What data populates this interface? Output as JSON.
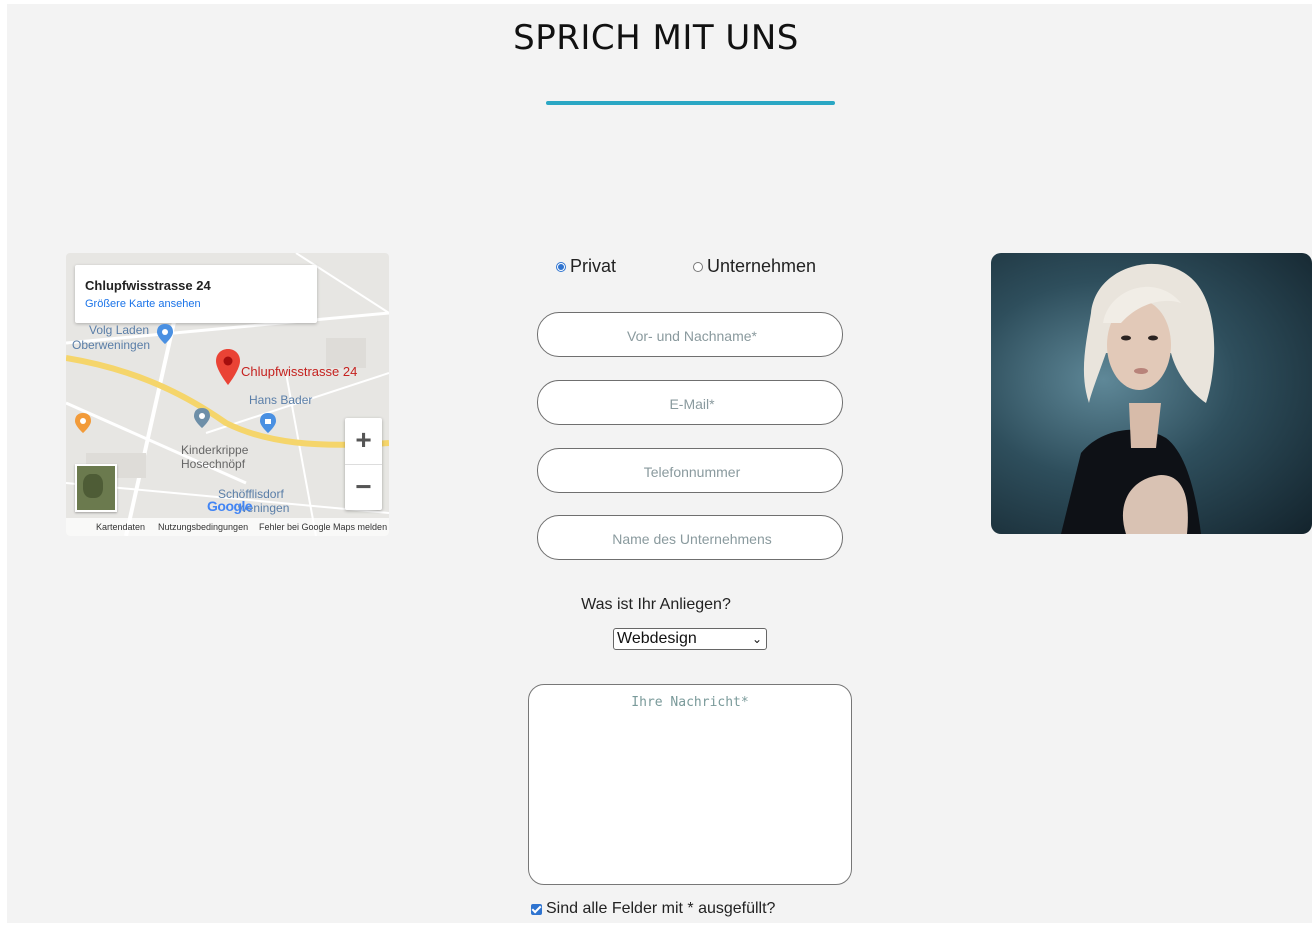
{
  "header": {
    "title": "SPRICH MIT UNS"
  },
  "map": {
    "address": "Chlupfwisstrasse 24",
    "larger_map_link": "Größere Karte ansehen",
    "marker_label": "Chlupfwisstrasse 24",
    "pois": {
      "volg": "Volg Laden",
      "oberweningen": "Oberweningen",
      "hans_bader": "Hans Bader",
      "kinderkrippe_1": "Kinderkrippe",
      "kinderkrippe_2": "Hosechnöpf",
      "schoefflisdorf_1": "Schöfflisdorf",
      "schoefflisdorf_2": "weningen"
    },
    "zoom_in": "+",
    "zoom_out": "−",
    "google_logo": "Google",
    "footer": {
      "map_data": "Kartendaten",
      "terms": "Nutzungsbedingungen",
      "report": "Fehler bei Google Maps melden"
    }
  },
  "form": {
    "radio_options": [
      {
        "label": "Privat",
        "selected": true
      },
      {
        "label": "Unternehmen",
        "selected": false
      }
    ],
    "fields": {
      "name_placeholder": "Vor- und Nachname*",
      "email_placeholder": "E-Mail*",
      "phone_placeholder": "Telefonnummer",
      "company_placeholder": "Name des Unternehmens"
    },
    "concern_label": "Was ist Ihr Anliegen?",
    "concern_selected": "Webdesign",
    "message_placeholder": "Ihre Nachricht*",
    "confirm_checkbox": {
      "label": "Sind alle Felder mit * ausgefüllt?",
      "checked": true
    }
  },
  "colors": {
    "accent_underline": "#2aa7c4",
    "background": "#f3f3f3",
    "radio_checkbox": "#2f74d0",
    "map_marker": "#ea4335"
  }
}
